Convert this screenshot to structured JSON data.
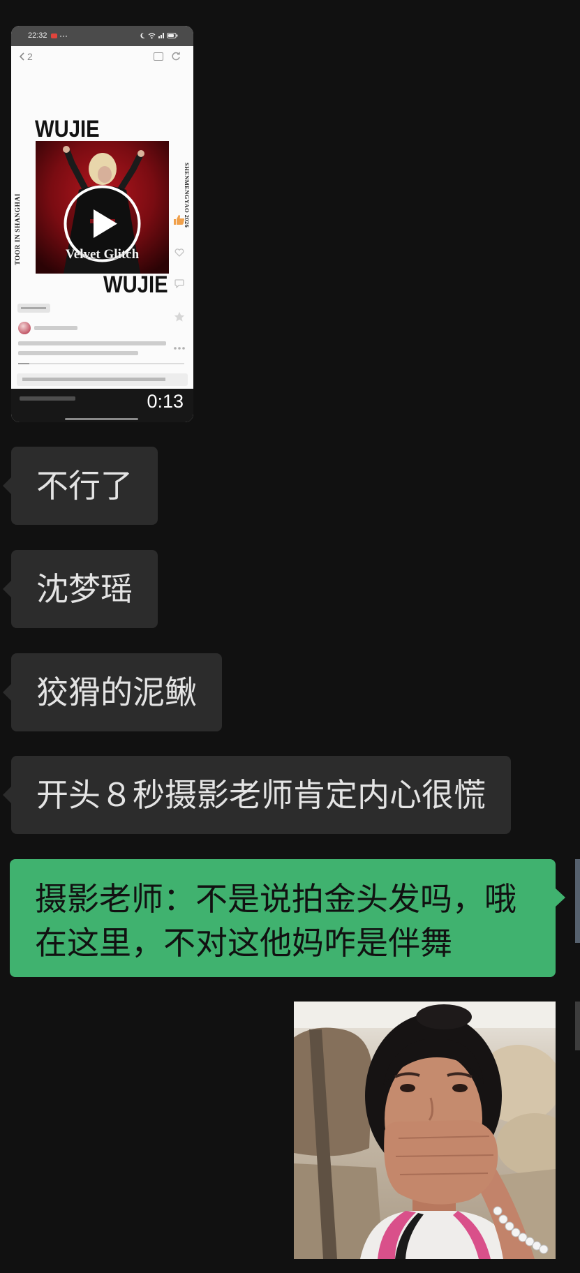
{
  "theme": {
    "background": "#111111",
    "incoming_bubble": "#2c2c2c",
    "incoming_text": "#e4e4e4",
    "outgoing_bubble": "#40b26f",
    "outgoing_text": "#111111"
  },
  "video_message": {
    "status_time": "22:32",
    "nav_count": "2",
    "poster_title_top": "WUJIE",
    "poster_title_bottom": "WUJIE",
    "poster_caption": "Velvet Glitch",
    "poster_side_left": "TOOR IN SHANGHAI",
    "poster_side_right": "SHENMENGYAO 2026",
    "duration": "0:13",
    "icons": [
      "back-chevron-icon",
      "screencast-icon",
      "refresh-icon",
      "play-icon",
      "thumbs-up-icon",
      "heart-icon",
      "comment-icon",
      "star-icon",
      "more-icon"
    ]
  },
  "chat": {
    "incoming": [
      "不行了",
      "沈梦瑶",
      "狡猾的泥鳅",
      "开头８秒摄影老师肯定内心很慌"
    ],
    "outgoing_lines": [
      "摄影老师：不是说拍金头发吗，哦",
      "在这里，不对这他妈咋是伴舞"
    ]
  }
}
